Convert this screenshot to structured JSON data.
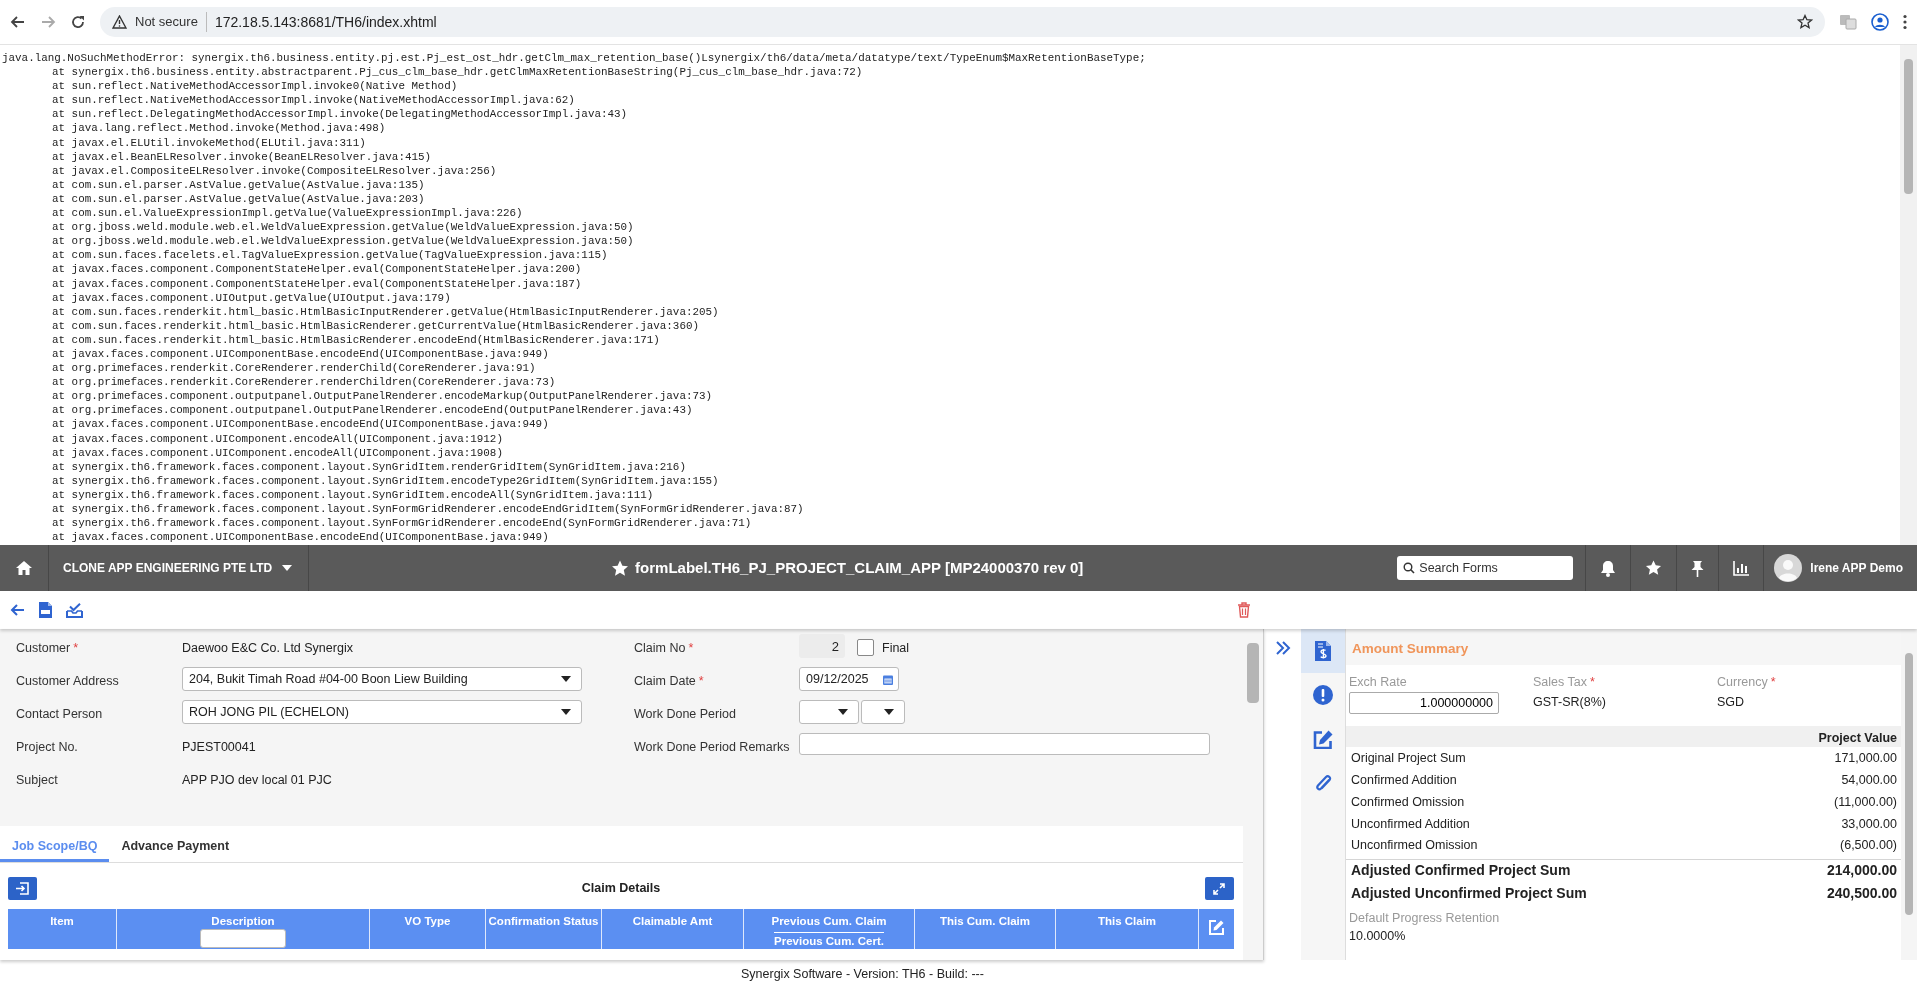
{
  "browser": {
    "security_label": "Not secure",
    "url": "172.18.5.143:8681/TH6/index.xhtml"
  },
  "stack_trace": {
    "message": "java.lang.NoSuchMethodError: synergix.th6.business.entity.pj.est.Pj_est_ost_hdr.getClm_max_retention_base()Lsynergix/th6/data/meta/datatype/text/TypeEnum$MaxRetentionBaseType;",
    "frames": [
      "at synergix.th6.business.entity.abstractparent.Pj_cus_clm_base_hdr.getClmMaxRetentionBaseString(Pj_cus_clm_base_hdr.java:72)",
      "at sun.reflect.NativeMethodAccessorImpl.invoke0(Native Method)",
      "at sun.reflect.NativeMethodAccessorImpl.invoke(NativeMethodAccessorImpl.java:62)",
      "at sun.reflect.DelegatingMethodAccessorImpl.invoke(DelegatingMethodAccessorImpl.java:43)",
      "at java.lang.reflect.Method.invoke(Method.java:498)",
      "at javax.el.ELUtil.invokeMethod(ELUtil.java:311)",
      "at javax.el.BeanELResolver.invoke(BeanELResolver.java:415)",
      "at javax.el.CompositeELResolver.invoke(CompositeELResolver.java:256)",
      "at com.sun.el.parser.AstValue.getValue(AstValue.java:135)",
      "at com.sun.el.parser.AstValue.getValue(AstValue.java:203)",
      "at com.sun.el.ValueExpressionImpl.getValue(ValueExpressionImpl.java:226)",
      "at org.jboss.weld.module.web.el.WeldValueExpression.getValue(WeldValueExpression.java:50)",
      "at org.jboss.weld.module.web.el.WeldValueExpression.getValue(WeldValueExpression.java:50)",
      "at com.sun.faces.facelets.el.TagValueExpression.getValue(TagValueExpression.java:115)",
      "at javax.faces.component.ComponentStateHelper.eval(ComponentStateHelper.java:200)",
      "at javax.faces.component.ComponentStateHelper.eval(ComponentStateHelper.java:187)",
      "at javax.faces.component.UIOutput.getValue(UIOutput.java:179)",
      "at com.sun.faces.renderkit.html_basic.HtmlBasicInputRenderer.getValue(HtmlBasicInputRenderer.java:205)",
      "at com.sun.faces.renderkit.html_basic.HtmlBasicRenderer.getCurrentValue(HtmlBasicRenderer.java:360)",
      "at com.sun.faces.renderkit.html_basic.HtmlBasicRenderer.encodeEnd(HtmlBasicRenderer.java:171)",
      "at javax.faces.component.UIComponentBase.encodeEnd(UIComponentBase.java:949)",
      "at org.primefaces.renderkit.CoreRenderer.renderChild(CoreRenderer.java:91)",
      "at org.primefaces.renderkit.CoreRenderer.renderChildren(CoreRenderer.java:73)",
      "at org.primefaces.component.outputpanel.OutputPanelRenderer.encodeMarkup(OutputPanelRenderer.java:73)",
      "at org.primefaces.component.outputpanel.OutputPanelRenderer.encodeEnd(OutputPanelRenderer.java:43)",
      "at javax.faces.component.UIComponentBase.encodeEnd(UIComponentBase.java:949)",
      "at javax.faces.component.UIComponent.encodeAll(UIComponent.java:1912)",
      "at javax.faces.component.UIComponent.encodeAll(UIComponent.java:1908)",
      "at synergix.th6.framework.faces.component.layout.SynGridItem.renderGridItem(SynGridItem.java:216)",
      "at synergix.th6.framework.faces.component.layout.SynGridItem.encodeType2GridItem(SynGridItem.java:155)",
      "at synergix.th6.framework.faces.component.layout.SynGridItem.encodeAll(SynGridItem.java:111)",
      "at synergix.th6.framework.faces.component.layout.SynFormGridRenderer.encodeEndGridItem(SynFormGridRenderer.java:87)",
      "at synergix.th6.framework.faces.component.layout.SynFormGridRenderer.encodeEnd(SynFormGridRenderer.java:71)",
      "at javax.faces.component.UIComponentBase.encodeEnd(UIComponentBase.java:949)"
    ]
  },
  "navbar": {
    "company": "CLONE APP ENGINEERING PTE LTD",
    "form_title": "formLabel.TH6_PJ_PROJECT_CLAIM_APP [MP24000370 rev 0]",
    "search": {
      "placeholder": "Search Forms"
    },
    "user": "Irene APP Demo"
  },
  "form": {
    "left_fields": [
      {
        "label": "Customer",
        "required_mark": "*",
        "kind": "text",
        "value": "Daewoo E&C Co. Ltd Synergix"
      },
      {
        "label": "Customer Address",
        "kind": "select",
        "value": "204, Bukit Timah Road #04-00 Boon Liew Building"
      },
      {
        "label": "Contact Person",
        "kind": "select",
        "value": "ROH JONG PIL (ECHELON)"
      },
      {
        "label": "Project No.",
        "kind": "text",
        "value": "PJEST00041"
      },
      {
        "label": "Subject",
        "kind": "text",
        "value": "APP PJO dev local 01 PJC"
      }
    ],
    "right_fields": [
      {
        "label": "Claim No",
        "required_mark": "*",
        "kind": "number",
        "value": "2",
        "checkbox": {
          "label": "Final",
          "checked": false
        }
      },
      {
        "label": "Claim Date",
        "required_mark": "*",
        "kind": "date",
        "value": "09/12/2025"
      },
      {
        "label": "Work Done Period",
        "kind": "period"
      },
      {
        "label": "Work Done Period Remarks",
        "kind": "input"
      }
    ]
  },
  "tabs": [
    {
      "label": "Job Scope/BQ",
      "selected": true
    },
    {
      "label": "Advance Payment",
      "selected": false
    }
  ],
  "claim_details": {
    "title": "Claim Details",
    "columns": [
      {
        "label": "Item",
        "kind": "plain"
      },
      {
        "label": "Description",
        "kind": "filter"
      },
      {
        "label": "VO Type",
        "kind": "plain"
      },
      {
        "label": "Confirmation Status",
        "kind": "plain"
      },
      {
        "label": "Claimable Amt",
        "kind": "plain"
      },
      {
        "label": "Previous Cum. Claim",
        "sublabel": "Previous Cum. Cert.",
        "kind": "plain"
      },
      {
        "label": "This Cum. Claim",
        "kind": "plain"
      },
      {
        "label": "This Claim",
        "kind": "plain"
      }
    ]
  },
  "amount_summary": {
    "side_tabs": [
      {
        "kind": "invoice",
        "selected": true
      },
      {
        "kind": "alert",
        "selected": false
      },
      {
        "kind": "edit",
        "selected": false
      },
      {
        "kind": "attachment",
        "selected": false
      }
    ],
    "title": "Amount Summary",
    "fields": [
      {
        "label": "Exch Rate",
        "kind": "input",
        "value": "1.000000000"
      },
      {
        "label": "Sales Tax",
        "required_mark": "*",
        "kind": "text",
        "value": "GST-SR(8%)"
      },
      {
        "label": "Currency",
        "required_mark": "*",
        "kind": "text",
        "value": "SGD"
      }
    ],
    "value_heading": "Project Value",
    "rows": [
      {
        "label": "Original Project Sum",
        "value": "171,000.00",
        "kind": "normal"
      },
      {
        "label": "Confirmed Addition",
        "value": "54,000.00",
        "kind": "normal"
      },
      {
        "label": "Confirmed Omission",
        "value": "(11,000.00)",
        "kind": "normal"
      },
      {
        "label": "Unconfirmed Addition",
        "value": "33,000.00",
        "kind": "normal"
      },
      {
        "label": "Unconfirmed Omission",
        "value": "(6,500.00)",
        "kind": "normal"
      },
      {
        "label": "Adjusted Confirmed Project Sum",
        "value": "214,000.00",
        "kind": "total"
      },
      {
        "label": "Adjusted Unconfirmed Project Sum",
        "value": "240,500.00",
        "kind": "total"
      }
    ],
    "retention": {
      "label": "Default Progress Retention",
      "value": "10.0000%"
    }
  },
  "footer": "Synergix Software - Version: TH6 - Build: ---"
}
